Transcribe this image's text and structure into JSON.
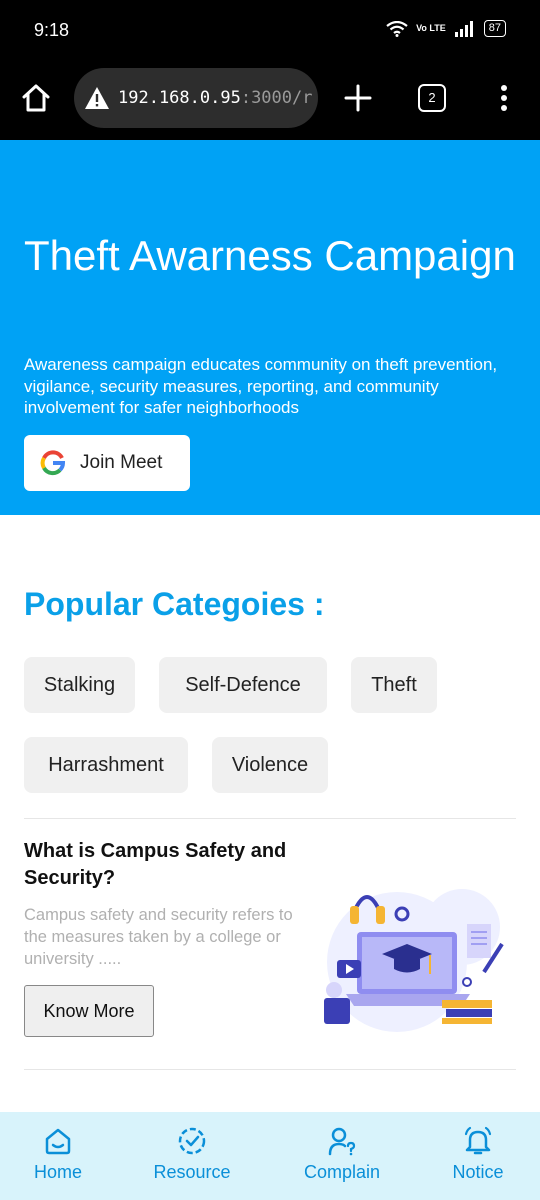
{
  "status_bar": {
    "time": "9:18",
    "battery": "87",
    "network_label": "Vo LTE"
  },
  "browser": {
    "url_main": "192.168.0.95",
    "url_dim": ":3000/r",
    "tab_count": "2"
  },
  "hero": {
    "title": "Theft Awarness Campaign",
    "description": "Awareness campaign educates community on theft prevention, vigilance, security measures, reporting, and community involvement for safer neighborhoods",
    "join_button": "Join Meet"
  },
  "categories": {
    "title": "Popular Categoies :",
    "items": [
      "Stalking",
      "Self-Defence",
      "Theft",
      "Harrashment",
      "Violence"
    ]
  },
  "info_card": {
    "title": "What is Campus Safety and Security?",
    "description": "Campus safety and security refers to the measures taken by a college or university .....",
    "button": "Know More"
  },
  "bottom_nav": {
    "items": [
      {
        "label": "Home",
        "icon": "home-icon"
      },
      {
        "label": "Resource",
        "icon": "check-circle-icon"
      },
      {
        "label": "Complain",
        "icon": "user-question-icon"
      },
      {
        "label": "Notice",
        "icon": "bell-icon"
      }
    ]
  },
  "colors": {
    "hero_bg": "#00a2f5",
    "accent": "#0aa0e8",
    "nav_bg": "#d8f3fb",
    "chip_bg": "#f0f0f0"
  }
}
